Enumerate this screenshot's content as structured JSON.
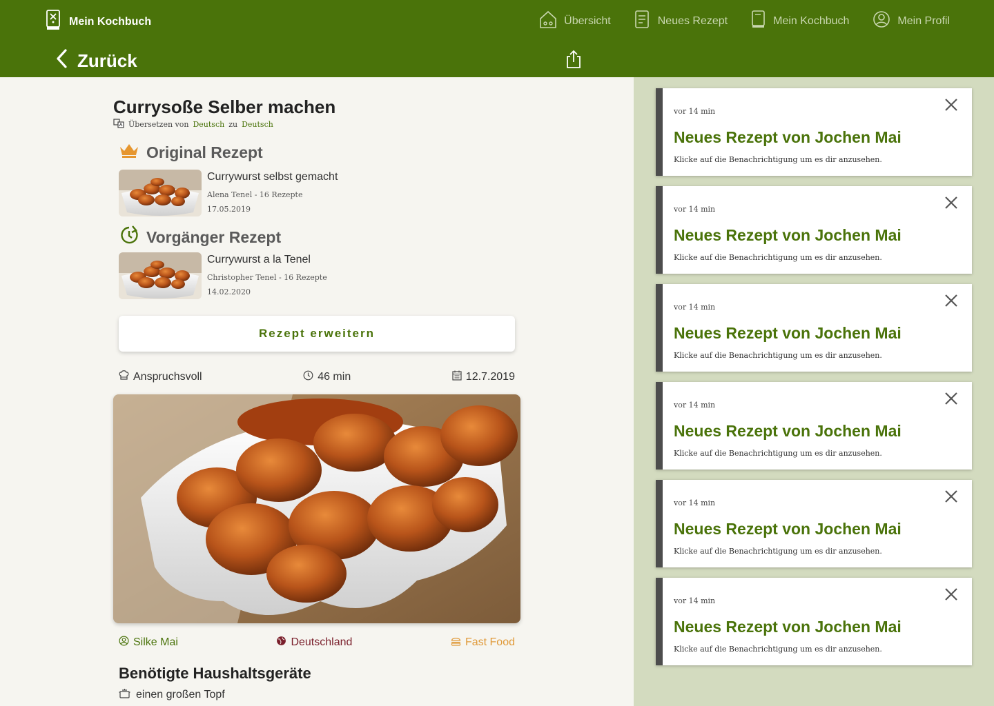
{
  "header": {
    "brand": "Mein Kochbuch",
    "nav": [
      {
        "label": "Übersicht",
        "icon": "home-icon"
      },
      {
        "label": "Neues Rezept",
        "icon": "new-recipe-icon"
      },
      {
        "label": "Mein Kochbuch",
        "icon": "cookbook-icon"
      },
      {
        "label": "Mein Profil",
        "icon": "profile-icon"
      }
    ],
    "back_label": "Zurück"
  },
  "recipe": {
    "title": "Currysoße Selber machen",
    "translate": {
      "prefix": "Übersetzen von",
      "from": "Deutsch",
      "mid": "zu",
      "to": "Deutsch"
    },
    "original_heading": "Original Rezept",
    "original": {
      "name": "Currywurst selbst gemacht",
      "author": "Alena Tenel - 16 Rezepte",
      "date": "17.05.2019"
    },
    "previous_heading": "Vorgänger Rezept",
    "previous": {
      "name": "Currywurst a la Tenel",
      "author": "Christopher Tenel - 16 Rezepte",
      "date": "14.02.2020"
    },
    "extend_label": "Rezept erweitern",
    "difficulty": "Anspruchsvoll",
    "duration": "46 min",
    "date": "12.7.2019",
    "tags": {
      "author": "Silke Mai",
      "country": "Deutschland",
      "category": "Fast Food"
    },
    "appliances_title": "Benötigte Haushaltsgeräte",
    "appliances": [
      "einen großen Topf"
    ]
  },
  "notifications": [
    {
      "time": "vor 14 min",
      "title": "Neues Rezept von Jochen Mai",
      "body": "Klicke auf die Benachrichtigung um es dir anzusehen."
    },
    {
      "time": "vor 14 min",
      "title": "Neues Rezept von Jochen Mai",
      "body": "Klicke auf die Benachrichtigung um es dir anzusehen."
    },
    {
      "time": "vor 14 min",
      "title": "Neues Rezept von Jochen Mai",
      "body": "Klicke auf die Benachrichtigung um es dir anzusehen."
    },
    {
      "time": "vor 14 min",
      "title": "Neues Rezept von Jochen Mai",
      "body": "Klicke auf die Benachrichtigung um es dir anzusehen."
    },
    {
      "time": "vor 14 min",
      "title": "Neues Rezept von Jochen Mai",
      "body": "Klicke auf die Benachrichtigung um es dir anzusehen."
    },
    {
      "time": "vor 14 min",
      "title": "Neues Rezept von Jochen Mai",
      "body": "Klicke auf die Benachrichtigung um es dir anzusehen."
    }
  ],
  "colors": {
    "brand_green": "#4a730a",
    "side_bg": "#d3dbbf",
    "tag_author": "#4a730a",
    "tag_country": "#7a1f2b",
    "tag_category": "#e09a3a"
  }
}
